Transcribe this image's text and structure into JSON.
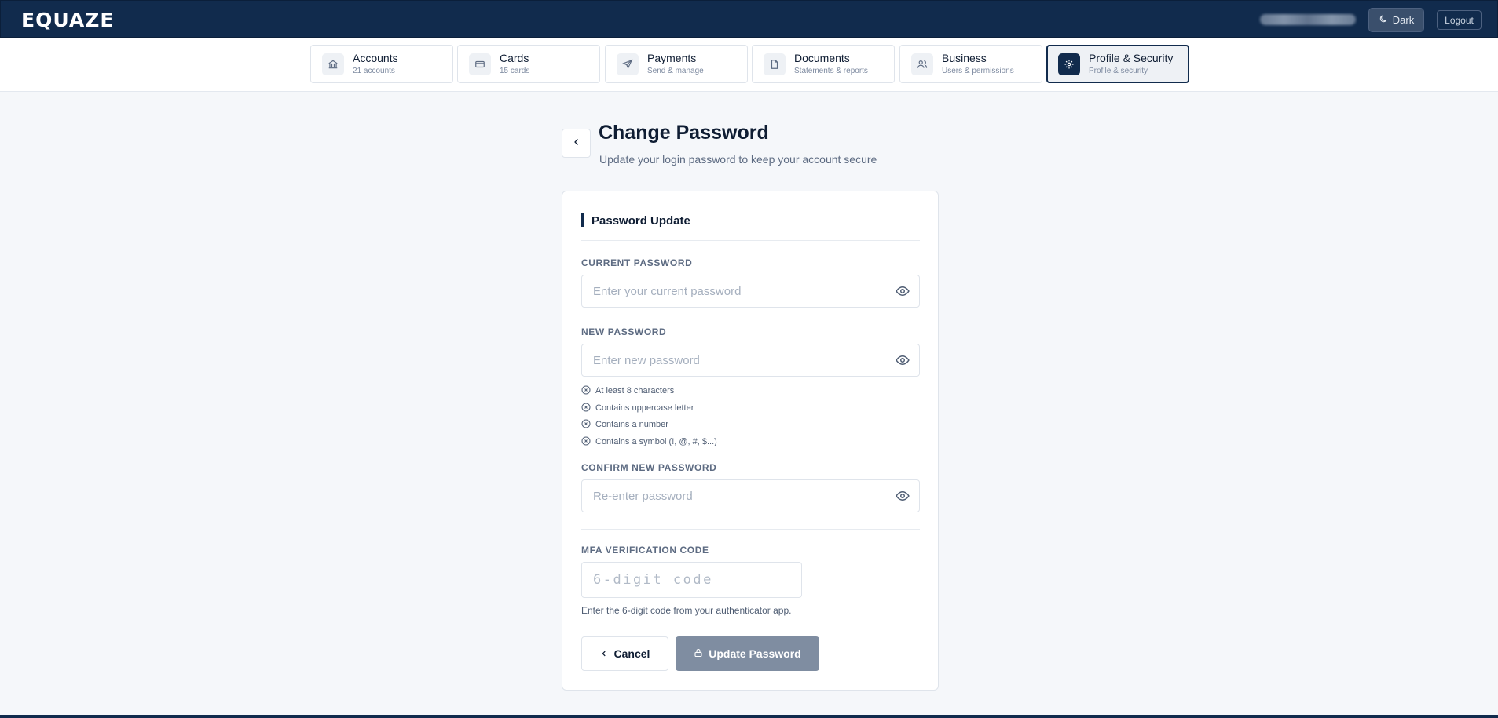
{
  "app": {
    "logo": "EQUAZE",
    "theme_toggle_label": "Dark",
    "logout_label": "Logout"
  },
  "nav": {
    "items": [
      {
        "title": "Accounts",
        "subtitle": "21 accounts",
        "icon": "bank-icon"
      },
      {
        "title": "Cards",
        "subtitle": "15 cards",
        "icon": "credit-card-icon"
      },
      {
        "title": "Payments",
        "subtitle": "Send & manage",
        "icon": "send-icon"
      },
      {
        "title": "Documents",
        "subtitle": "Statements & reports",
        "icon": "document-icon"
      },
      {
        "title": "Business",
        "subtitle": "Users & permissions",
        "icon": "users-icon"
      },
      {
        "title": "Profile & Security",
        "subtitle": "Profile & security",
        "icon": "gear-icon",
        "active": true
      }
    ]
  },
  "page": {
    "title": "Change Password",
    "subtitle": "Update your login password to keep your account secure"
  },
  "form": {
    "section_title": "Password Update",
    "current_password": {
      "label": "CURRENT PASSWORD",
      "placeholder": "Enter your current password",
      "value": ""
    },
    "new_password": {
      "label": "NEW PASSWORD",
      "placeholder": "Enter new password",
      "value": ""
    },
    "requirements": [
      "At least 8 characters",
      "Contains uppercase letter",
      "Contains a number",
      "Contains a symbol (!, @, #, $...)"
    ],
    "confirm_password": {
      "label": "CONFIRM NEW PASSWORD",
      "placeholder": "Re-enter password",
      "value": ""
    },
    "mfa": {
      "label": "MFA VERIFICATION CODE",
      "placeholder": "6-digit code",
      "value": "",
      "help": "Enter the 6-digit code from your authenticator app."
    },
    "cancel_label": "Cancel",
    "submit_label": "Update Password"
  },
  "colors": {
    "brand": "#112b4d",
    "submit_disabled": "#7f8da1",
    "background": "#f5f7fa"
  }
}
